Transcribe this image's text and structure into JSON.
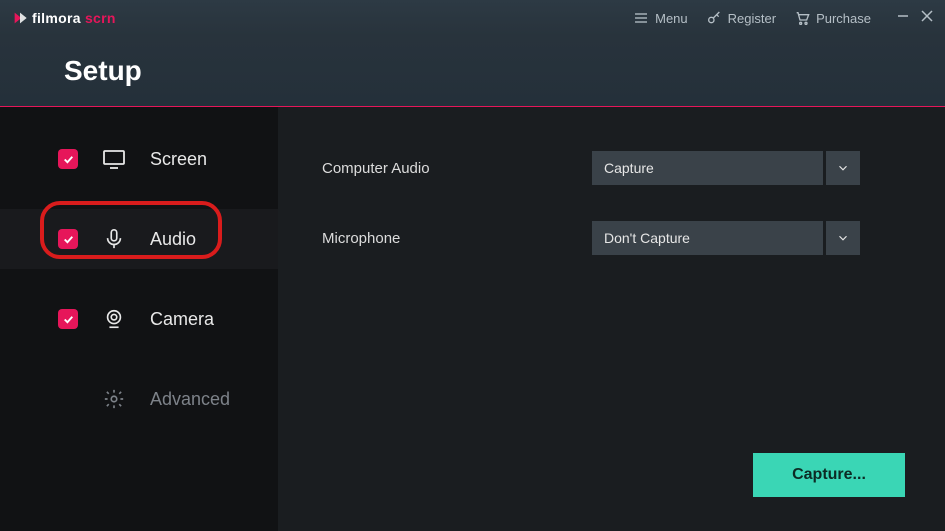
{
  "brand": {
    "prefix": "filmora",
    "suffix": " scrn"
  },
  "titlebar": {
    "menu": "Menu",
    "register": "Register",
    "purchase": "Purchase"
  },
  "page_title": "Setup",
  "sidebar": {
    "items": [
      {
        "label": "Screen",
        "checked": true,
        "icon": "monitor"
      },
      {
        "label": "Audio",
        "checked": true,
        "icon": "mic",
        "active": true,
        "highlighted": true
      },
      {
        "label": "Camera",
        "checked": true,
        "icon": "webcam"
      },
      {
        "label": "Advanced",
        "checked": false,
        "icon": "gear"
      }
    ]
  },
  "settings": {
    "computer_audio": {
      "label": "Computer Audio",
      "value": "Capture"
    },
    "microphone": {
      "label": "Microphone",
      "value": "Don't Capture"
    }
  },
  "capture_button": "Capture...",
  "colors": {
    "accent": "#e6165a",
    "cta": "#3ad6b5"
  }
}
